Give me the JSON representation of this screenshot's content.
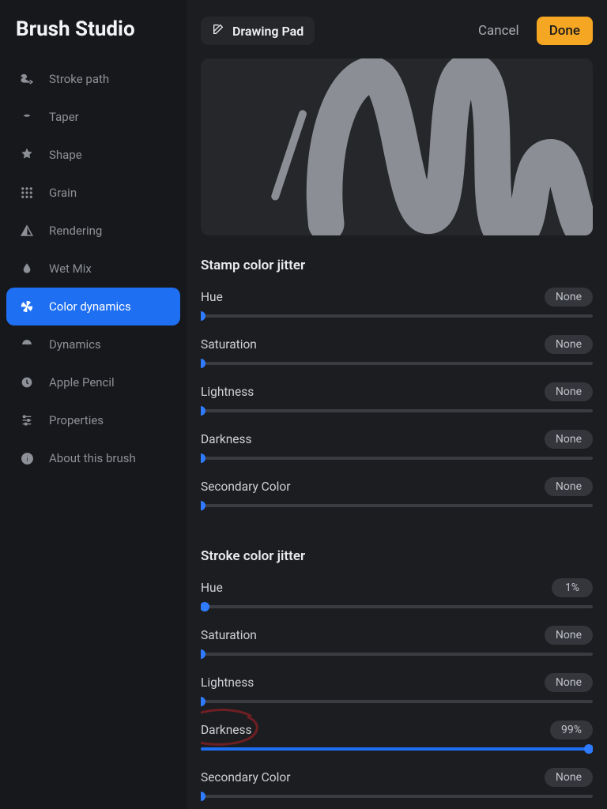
{
  "app_title": "Brush Studio",
  "sidebar": {
    "items": [
      {
        "id": "stroke-path",
        "label": "Stroke path"
      },
      {
        "id": "taper",
        "label": "Taper"
      },
      {
        "id": "shape",
        "label": "Shape"
      },
      {
        "id": "grain",
        "label": "Grain"
      },
      {
        "id": "rendering",
        "label": "Rendering"
      },
      {
        "id": "wet-mix",
        "label": "Wet Mix"
      },
      {
        "id": "color-dynamics",
        "label": "Color dynamics"
      },
      {
        "id": "dynamics",
        "label": "Dynamics"
      },
      {
        "id": "apple-pencil",
        "label": "Apple Pencil"
      },
      {
        "id": "properties",
        "label": "Properties"
      },
      {
        "id": "about",
        "label": "About this brush"
      }
    ],
    "active_index": 6
  },
  "topbar": {
    "drawing_pad_label": "Drawing Pad",
    "cancel_label": "Cancel",
    "done_label": "Done"
  },
  "sections": {
    "stamp": {
      "title": "Stamp color jitter",
      "hue": {
        "label": "Hue",
        "value_text": "None",
        "percent": 0
      },
      "saturation": {
        "label": "Saturation",
        "value_text": "None",
        "percent": 0
      },
      "lightness": {
        "label": "Lightness",
        "value_text": "None",
        "percent": 0
      },
      "darkness": {
        "label": "Darkness",
        "value_text": "None",
        "percent": 0
      },
      "secondary": {
        "label": "Secondary Color",
        "value_text": "None",
        "percent": 0
      }
    },
    "stroke": {
      "title": "Stroke color jitter",
      "hue": {
        "label": "Hue",
        "value_text": "1%",
        "percent": 1
      },
      "saturation": {
        "label": "Saturation",
        "value_text": "None",
        "percent": 0
      },
      "lightness": {
        "label": "Lightness",
        "value_text": "None",
        "percent": 0
      },
      "darkness": {
        "label": "Darkness",
        "value_text": "99%",
        "percent": 99
      },
      "secondary": {
        "label": "Secondary Color",
        "value_text": "None",
        "percent": 0
      }
    }
  },
  "colors": {
    "accent": "#1e6ff2",
    "done_button": "#f5a623"
  }
}
